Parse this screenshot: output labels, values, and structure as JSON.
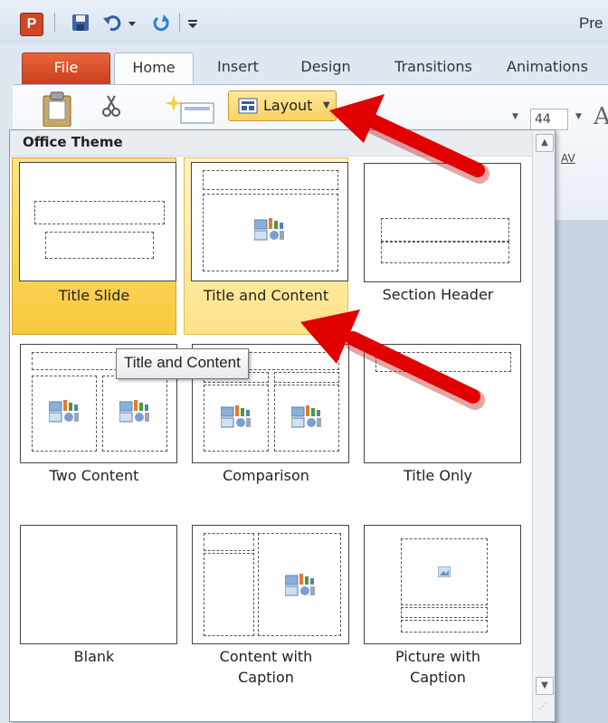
{
  "app": {
    "logo_letter": "P",
    "title": "Pre"
  },
  "tabs": [
    {
      "label": "File"
    },
    {
      "label": "Home"
    },
    {
      "label": "Insert"
    },
    {
      "label": "Design"
    },
    {
      "label": "Transitions"
    },
    {
      "label": "Animations"
    }
  ],
  "ribbon": {
    "layout_label": "Layout",
    "font_size": "44",
    "font_glyph": "A",
    "spacing_glyph": "AV"
  },
  "gallery": {
    "header": "Office Theme",
    "items": [
      {
        "label": "Title Slide",
        "state": "selected"
      },
      {
        "label": "Title and Content",
        "state": "hover"
      },
      {
        "label": "Section Header",
        "state": "normal"
      },
      {
        "label": "Two Content",
        "state": "normal"
      },
      {
        "label": "Comparison",
        "state": "normal"
      },
      {
        "label": "Title Only",
        "state": "normal"
      },
      {
        "label": "Blank",
        "state": "normal"
      },
      {
        "label": "Content with Caption",
        "state": "normal"
      },
      {
        "label": "Picture with Caption",
        "state": "normal"
      }
    ]
  },
  "tooltip": "Title and Content",
  "colors": {
    "file_tab": "#c8401d",
    "hover": "#fde38a",
    "arrow": "#e00000"
  }
}
